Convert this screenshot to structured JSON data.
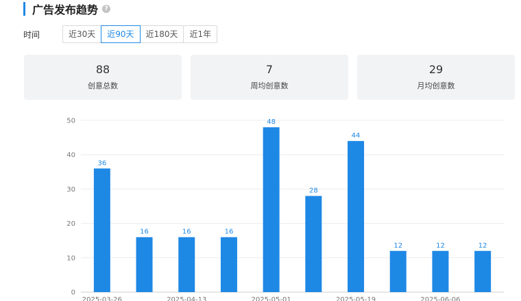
{
  "header": {
    "title": "广告发布趋势",
    "help_glyph": "?"
  },
  "time_filter": {
    "label": "时间",
    "options": [
      "近30天",
      "近90天",
      "近180天",
      "近1年"
    ],
    "selected_index": 1
  },
  "stats": [
    {
      "value": "88",
      "label": "创意总数"
    },
    {
      "value": "7",
      "label": "周均创意数"
    },
    {
      "value": "29",
      "label": "月均创意数"
    }
  ],
  "colors": {
    "accent": "#1e88e5",
    "card_bg": "#f2f3f5"
  },
  "chart_data": {
    "type": "bar",
    "categories": [
      "2025-03-26",
      "",
      "2025-04-13",
      "",
      "2025-05-01",
      "",
      "2025-05-19",
      "",
      "2025-06-06",
      ""
    ],
    "values": [
      36,
      16,
      16,
      16,
      48,
      28,
      44,
      12,
      12,
      12
    ],
    "ylim": [
      0,
      50
    ],
    "yticks": [
      0,
      10,
      20,
      30,
      40,
      50
    ],
    "grid": true,
    "show_data_labels": true
  }
}
